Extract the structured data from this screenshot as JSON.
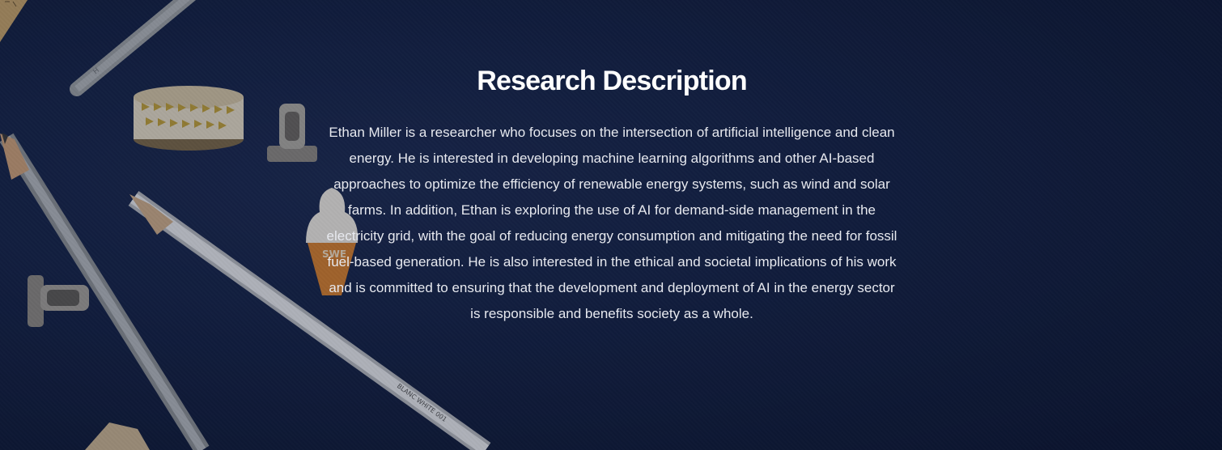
{
  "section": {
    "title": "Research Description",
    "description": "Ethan Miller is a researcher who focuses on the intersection of artificial intelligence and clean energy. He is interested in developing machine learning algorithms and other AI-based approaches to optimize the efficiency of renewable energy systems, such as wind and solar farms. In addition, Ethan is exploring the use of AI for demand-side management in the electricity grid, with the goal of reducing energy consumption and mitigating the need for fossil fuel-based generation. He is also interested in the ethical and societal implications of his work and is committed to ensuring that the development and deployment of AI in the energy sector is responsible and benefits society as a whole."
  },
  "background": {
    "pencil_label_top": "H",
    "pencil_label_bottom": "BLANC WHITE 001",
    "cone_label": "SWE"
  },
  "colors": {
    "background": "#142246",
    "title": "#ffffff",
    "text": "#e7e9ef"
  }
}
